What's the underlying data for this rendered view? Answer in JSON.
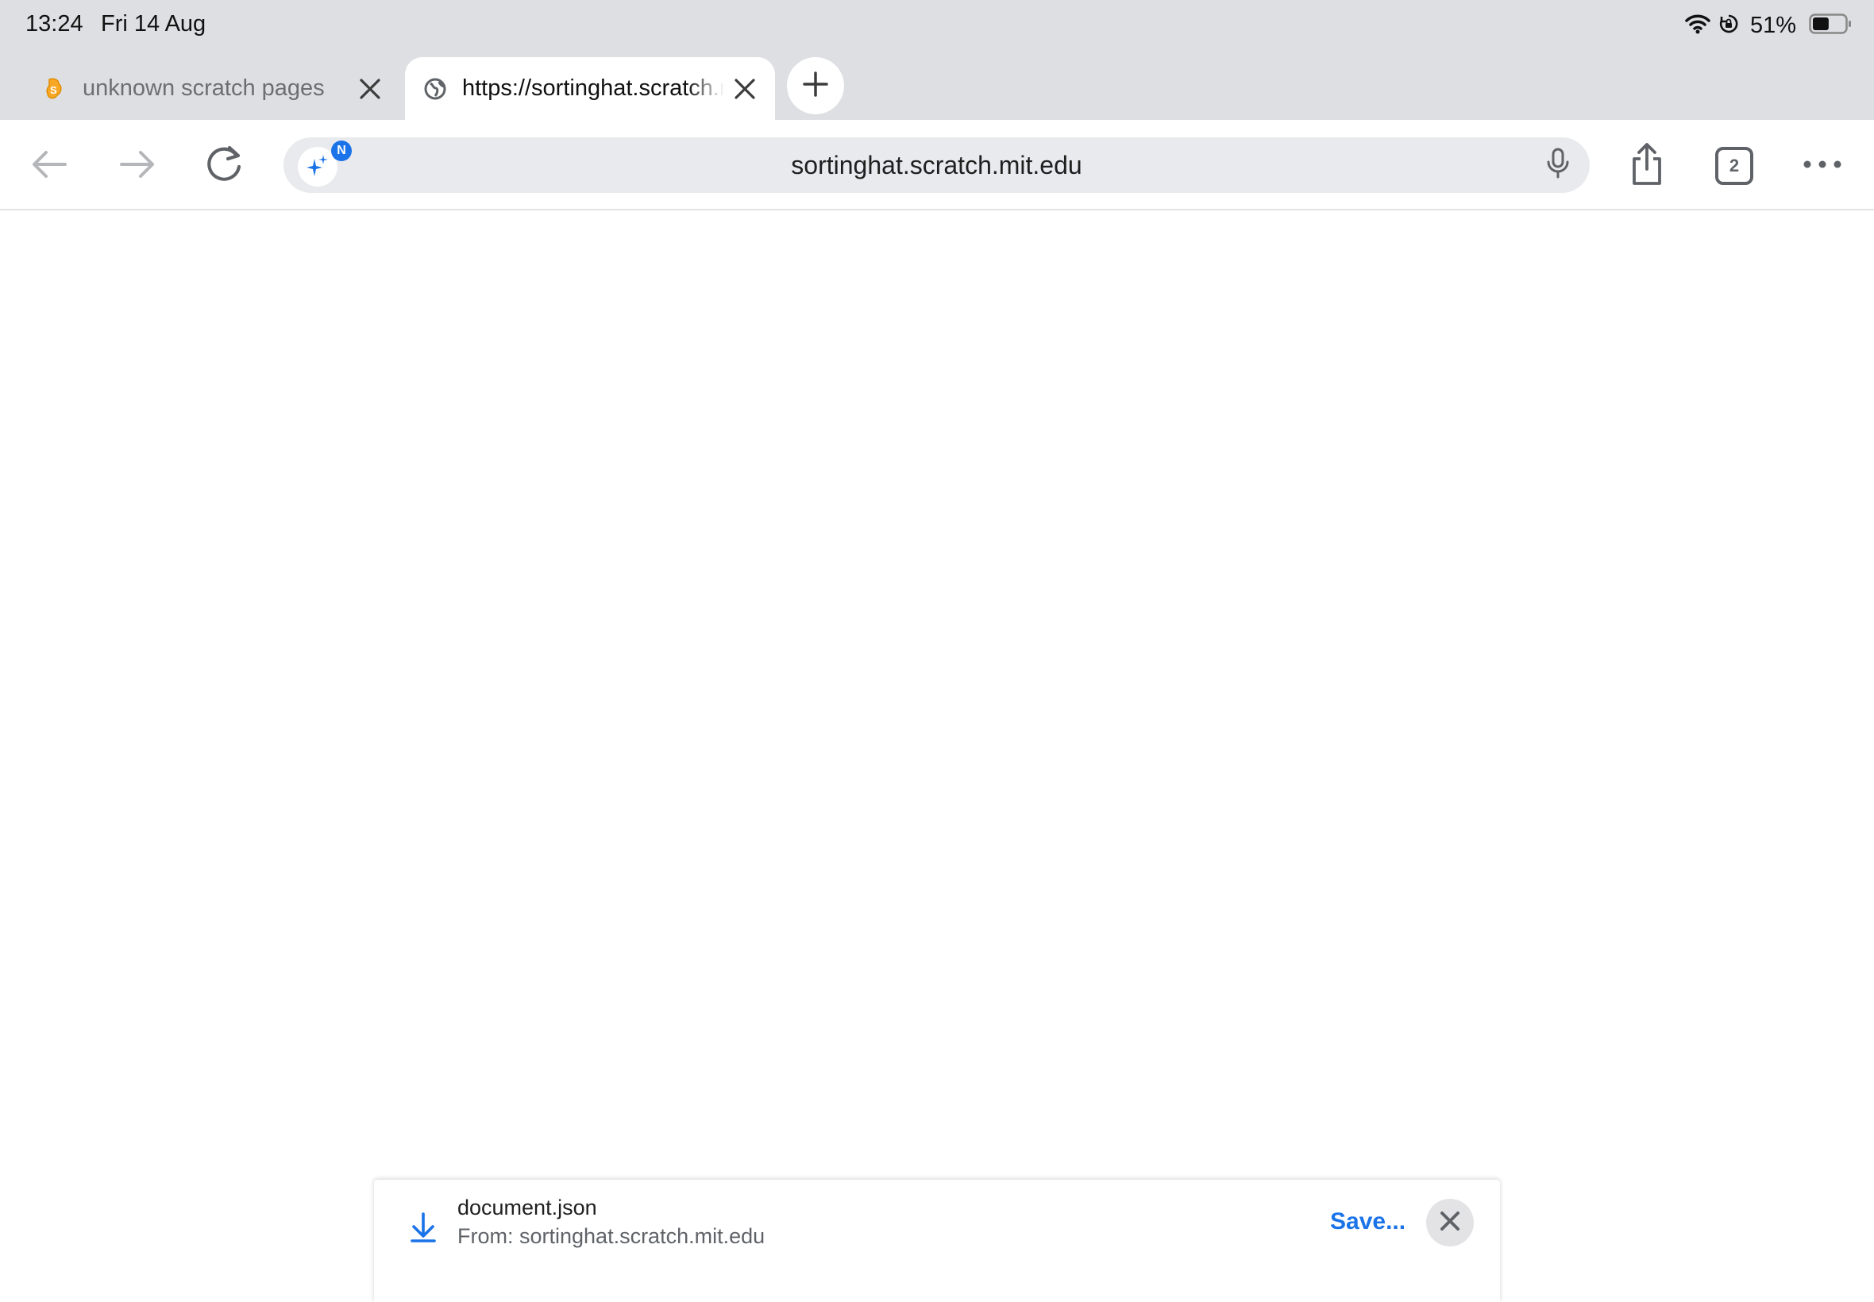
{
  "status_bar": {
    "time": "13:24",
    "date": "Fri 14 Aug",
    "battery_percent": "51%",
    "battery_level": 0.51
  },
  "tabs": [
    {
      "title": "unknown scratch pages",
      "favicon": "scratch-cat-icon",
      "active": false
    },
    {
      "title": "https://sortinghat.scratch.mit.edu",
      "favicon": "globe-icon",
      "active": true
    }
  ],
  "toolbar": {
    "url": "sortinghat.scratch.mit.edu",
    "ai_badge": "N",
    "tab_count": "2"
  },
  "download": {
    "filename": "document.json",
    "source": "From: sortinghat.scratch.mit.edu",
    "save_label": "Save..."
  },
  "colors": {
    "chrome_bg": "#dedfe3",
    "accent": "#1a73e8",
    "icon_gray": "#5f6368"
  }
}
